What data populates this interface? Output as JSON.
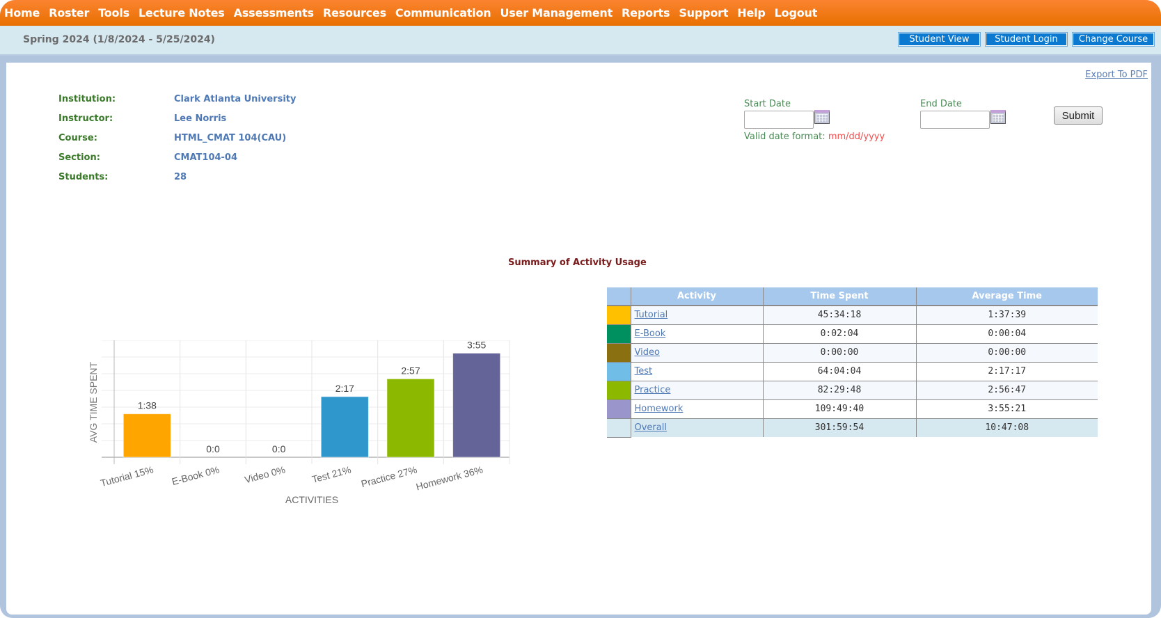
{
  "nav": {
    "items": [
      "Home",
      "Roster",
      "Tools",
      "Lecture Notes",
      "Assessments",
      "Resources",
      "Communication",
      "User Management",
      "Reports",
      "Support",
      "Help",
      "Logout"
    ]
  },
  "subbar": {
    "term": "Spring 2024 (1/8/2024 - 5/25/2024)",
    "buttons": [
      "Student View",
      "Student Login",
      "Change Course"
    ]
  },
  "export_label": "Export To PDF",
  "info": {
    "rows": [
      {
        "label": "Institution:",
        "value": "Clark Atlanta University"
      },
      {
        "label": "Instructor:",
        "value": "Lee Norris"
      },
      {
        "label": "Course:",
        "value": "HTML_CMAT 104(CAU)"
      },
      {
        "label": "Section:",
        "value": "CMAT104-04"
      },
      {
        "label": "Students:",
        "value": "28"
      }
    ]
  },
  "dates": {
    "start_label": "Start Date",
    "start_value": "",
    "end_label": "End Date",
    "end_value": "",
    "hint_label": "Valid date format:",
    "hint_format": "mm/dd/yyyy",
    "submit_label": "Submit"
  },
  "summary_title": "Summary of Activity Usage",
  "chart_data": {
    "type": "bar",
    "title": "",
    "xlabel": "ACTIVITIES",
    "ylabel": "AVG TIME SPENT",
    "categories": [
      "Tutorial 15%",
      "E-Book 0%",
      "Video 0%",
      "Test 21%",
      "Practice 27%",
      "Homework 36%"
    ],
    "values": [
      1.633,
      0,
      0,
      2.283,
      2.95,
      3.917
    ],
    "value_labels": [
      "1:38",
      "0:0",
      "0:0",
      "2:17",
      "2:57",
      "3:55"
    ],
    "colors": [
      "#ffa500",
      "#1a8a5a",
      "#8a6d0a",
      "#3097cd",
      "#8cb800",
      "#656498"
    ],
    "ylim": [
      0,
      4.4
    ],
    "grid": true,
    "legend": "none"
  },
  "table": {
    "headers": [
      "",
      "Activity",
      "Time Spent",
      "Average Time"
    ],
    "rows": [
      {
        "color": "#ffc000",
        "activity": "Tutorial",
        "time_spent": "45:34:18",
        "average_time": "1:37:39"
      },
      {
        "color": "#009060",
        "activity": "E-Book",
        "time_spent": "0:02:04",
        "average_time": "0:00:04"
      },
      {
        "color": "#8a7010",
        "activity": "Video",
        "time_spent": "0:00:00",
        "average_time": "0:00:00"
      },
      {
        "color": "#70bde8",
        "activity": "Test",
        "time_spent": "64:04:04",
        "average_time": "2:17:17"
      },
      {
        "color": "#8cb800",
        "activity": "Practice",
        "time_spent": "82:29:48",
        "average_time": "2:56:47"
      },
      {
        "color": "#9a96cc",
        "activity": "Homework",
        "time_spent": "109:49:40",
        "average_time": "3:55:21"
      }
    ],
    "overall": {
      "activity": "Overall",
      "time_spent": "301:59:54",
      "average_time": "10:47:08"
    }
  }
}
